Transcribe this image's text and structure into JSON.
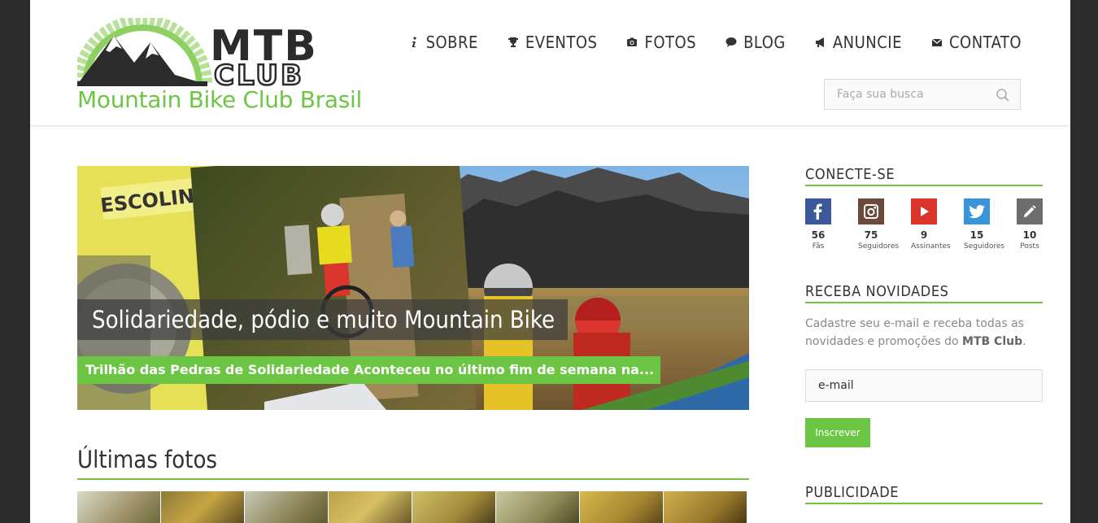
{
  "header": {
    "logo_top": "MTB",
    "logo_bottom": "CLUB",
    "logo_subtitle": "Mountain Bike Club Brasil",
    "nav": [
      {
        "label": "SOBRE",
        "icon": "info-icon"
      },
      {
        "label": "EVENTOS",
        "icon": "trophy-icon"
      },
      {
        "label": "FOTOS",
        "icon": "camera-icon"
      },
      {
        "label": "BLOG",
        "icon": "speech-bubble-icon"
      },
      {
        "label": "ANUNCIE",
        "icon": "megaphone-icon"
      },
      {
        "label": "CONTATO",
        "icon": "envelope-icon"
      }
    ],
    "search_placeholder": "Faça sua busca"
  },
  "hero": {
    "title": "Solidariedade, pódio e muito Mountain Bike",
    "subtitle": "Trilhão das Pedras de Solidariedade Aconteceu no último fim de semana na..."
  },
  "photos_section": {
    "title": "Últimas fotos"
  },
  "sidebar": {
    "connect_title": "CONECTE-SE",
    "social": [
      {
        "name": "facebook-icon",
        "count": "56",
        "label": "Fãs",
        "color": "#3b5998"
      },
      {
        "name": "instagram-icon",
        "count": "75",
        "label": "Seguidores",
        "color": "#6b4a3a"
      },
      {
        "name": "youtube-icon",
        "count": "9",
        "label": "Assinantes",
        "color": "#d9352c"
      },
      {
        "name": "twitter-icon",
        "count": "15",
        "label": "Seguidores",
        "color": "#3a95d8"
      },
      {
        "name": "pencil-icon",
        "count": "10",
        "label": "Posts",
        "color": "#6d6d6d"
      }
    ],
    "newsletter_title": "RECEBA NOVIDADES",
    "newsletter_text_pre": "Cadastre seu e-mail e receba todas as novidades e promoções do ",
    "newsletter_text_brand": "MTB Club",
    "newsletter_text_post": ".",
    "email_placeholder": "e-mail",
    "subscribe_label": "Inscrever",
    "ads_title": "PUBLICIDADE"
  },
  "colors": {
    "accent": "#6cc644",
    "text": "#333333",
    "background": "#2b2b2b"
  }
}
